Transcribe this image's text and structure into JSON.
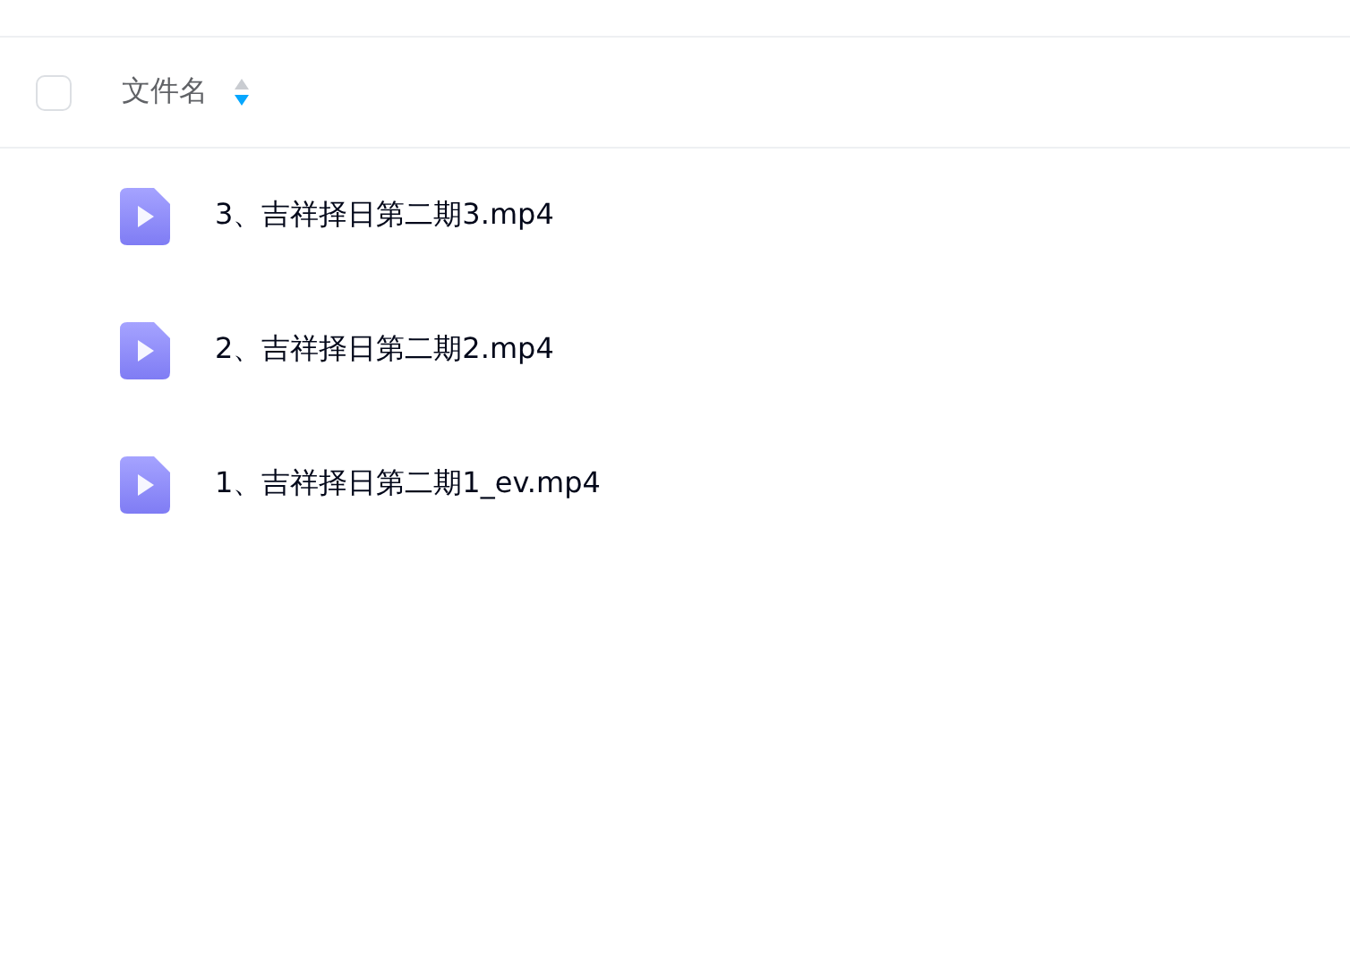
{
  "header": {
    "select_all": {
      "checked": false
    },
    "column": "文件名",
    "sort_descending": true
  },
  "files": [
    {
      "name": "3、吉祥择日第二期3.mp4",
      "kind": "video"
    },
    {
      "name": "2、吉祥择日第二期2.mp4",
      "kind": "video"
    },
    {
      "name": "1、吉祥择日第二期1_ev.mp4",
      "kind": "video"
    }
  ]
}
